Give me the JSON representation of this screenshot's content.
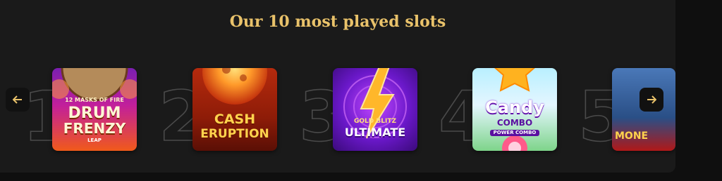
{
  "section_title": "Our 10 most played slots",
  "nav": {
    "prev_icon": "arrow-left-icon",
    "next_icon": "arrow-right-icon",
    "accent": "#e9c26a"
  },
  "slots": [
    {
      "rank": "1",
      "game": "12 Masks of Fire Drum Frenzy",
      "line1": "12 MASKS OF FIRE",
      "line2": "DRUM",
      "line3": "FRENZY",
      "line4": "LEAP"
    },
    {
      "rank": "2",
      "game": "Cash Eruption",
      "line1": "CASH",
      "line2": "ERUPTION"
    },
    {
      "rank": "3",
      "game": "Gold Blitz Ultimate",
      "line1": "GOLD",
      "line2": "BLITZ",
      "line3": "ULTIMATE"
    },
    {
      "rank": "4",
      "game": "Candy Combo Power Combo",
      "line1": "Candy",
      "line2": "COMBO",
      "line3": "POWER COMBO"
    },
    {
      "rank": "5",
      "game": "Money",
      "line1": "MONE"
    }
  ]
}
